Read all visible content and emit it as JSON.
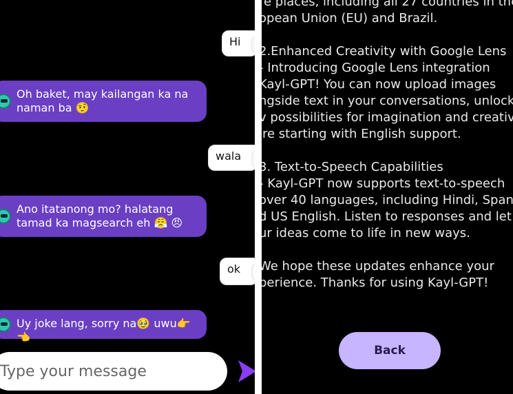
{
  "chat": {
    "messages": [
      {
        "role": "user",
        "text": "Hi"
      },
      {
        "role": "bot",
        "text": "Oh baket, may kailangan ka na naman ba 🤨"
      },
      {
        "role": "user",
        "text": "wala"
      },
      {
        "role": "bot",
        "text": "Ano itatanong mo? halatang tamad ka magsearch eh 😤 😠"
      },
      {
        "role": "user",
        "text": "ok"
      },
      {
        "role": "bot",
        "text": "Uy joke lang, sorry na🥹 uwu👉👈"
      }
    ],
    "input_placeholder": "Type your message"
  },
  "updates": {
    "lines": [
      "re places, including all 27 countries in the",
      "opean Union (EU) and Brazil.",
      "",
      "2.Enhanced Creativity with Google Lens",
      "   - Introducing Google Lens integration",
      "Kayl-GPT! You can now upload images",
      "ngside text in your conversations, unlock",
      "v possibilities for imagination and creativ",
      "'re starting with English support.",
      "",
      "3. Text-to-Speech Capabilities",
      "   - Kayl-GPT now supports text-to-speech",
      "over 40 languages, including Hindi, Spanis",
      "d US English. Listen to responses and let",
      "ur ideas come to life in new ways.",
      "",
      "We hope these updates enhance your",
      "perience. Thanks for using Kayl-GPT!"
    ],
    "back_label": "Back"
  },
  "colors": {
    "bot_bubble": "#6a3fc4",
    "user_bubble": "#ffffff",
    "send_arrow": "#8a3df2",
    "back_button": "#c7b5ff",
    "background": "#000000"
  }
}
